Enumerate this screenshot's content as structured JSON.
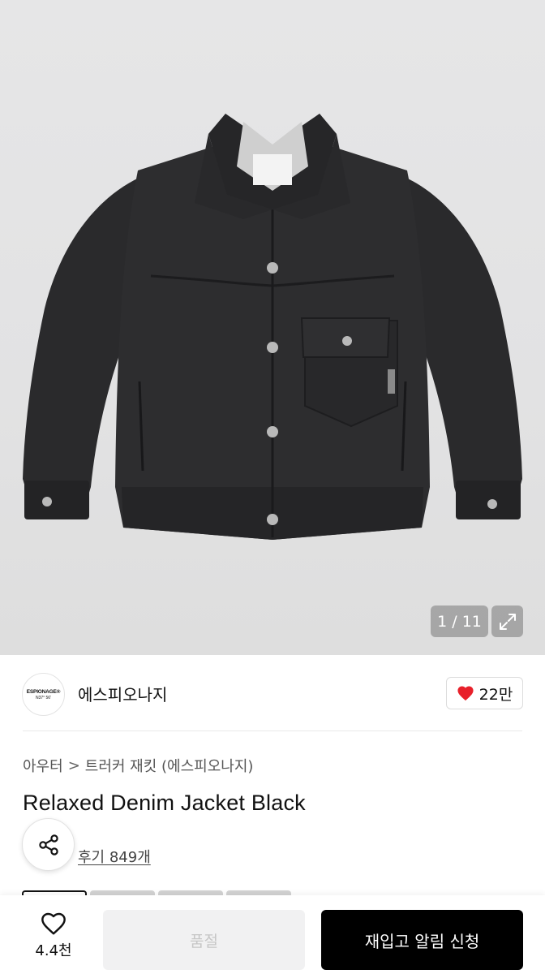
{
  "gallery": {
    "counter": "1 / 11"
  },
  "brand": {
    "logo_line1": "ESPIONAGE®",
    "logo_line2": "N37° 56'",
    "name": "에스피오나지",
    "likes": "22만"
  },
  "breadcrumb": {
    "category": "아우터",
    "separator": ">",
    "subcategory": "트러커 재킷 (에스피오나지)"
  },
  "product": {
    "title": "Relaxed Denim Jacket Black",
    "reviews": "후기 849개"
  },
  "bottom_bar": {
    "wish_count": "4.4천",
    "soldout_label": "품절",
    "restock_label": "재입고 알림 신청"
  },
  "colors": {
    "heart": "#e8202a",
    "primary_button": "#000000",
    "disabled_button": "#f1f1f2"
  },
  "icons": [
    "expand-icon",
    "heart-icon",
    "share-icon",
    "heart-outline-icon"
  ]
}
